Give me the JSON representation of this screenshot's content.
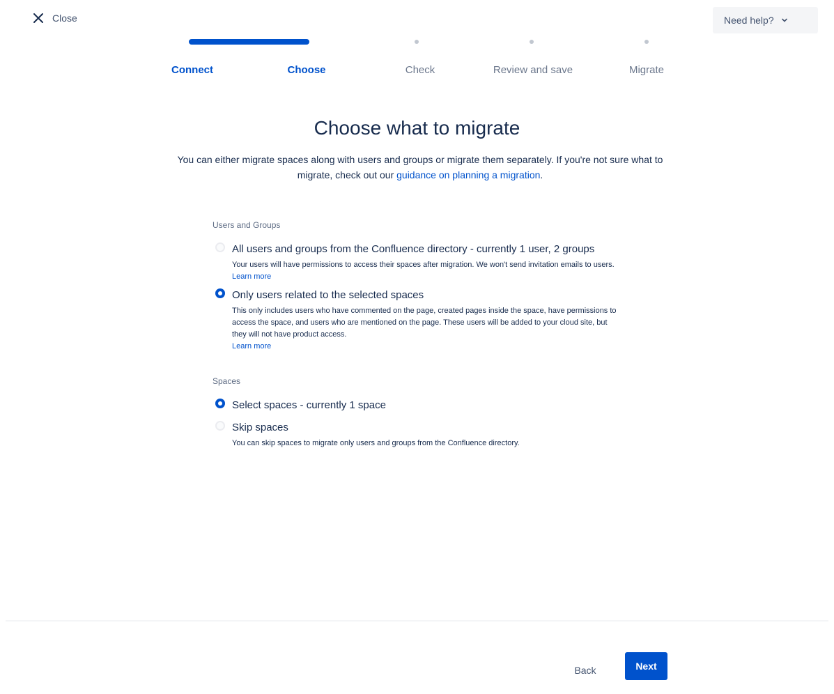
{
  "header": {
    "close_label": "Close",
    "help_label": "Need help?"
  },
  "steps": [
    {
      "label": "Connect",
      "state": "done"
    },
    {
      "label": "Choose",
      "state": "current"
    },
    {
      "label": "Check",
      "state": "pending"
    },
    {
      "label": "Review and save",
      "state": "pending"
    },
    {
      "label": "Migrate",
      "state": "pending"
    }
  ],
  "main": {
    "title": "Choose what to migrate",
    "intro_text": "You can either migrate spaces along with users and groups or migrate them separately. If you're not sure what to migrate, check out our ",
    "intro_link": "guidance on planning a migration",
    "intro_end": "."
  },
  "users_groups": {
    "section_label": "Users and Groups",
    "options": [
      {
        "title": "All users and groups from the Confluence directory - currently 1 user, 2 groups",
        "desc": "Your users will have permissions to access their spaces after migration. We won't send invitation emails to users. ",
        "link": "Learn more",
        "checked": false
      },
      {
        "title": "Only users related to the selected spaces",
        "desc": "This only includes users who have commented on the page, created pages inside the space, have permissions to access the space, and users who are mentioned on the page. These users will be added to your cloud site, but they will not have product access.",
        "link": "Learn more",
        "checked": true
      }
    ]
  },
  "spaces": {
    "section_label": "Spaces",
    "options": [
      {
        "title": "Select spaces - currently 1 space",
        "checked": true
      },
      {
        "title": "Skip spaces",
        "desc": "You can skip spaces to migrate only users and groups from the Confluence directory.",
        "checked": false
      }
    ]
  },
  "footer": {
    "back_label": "Back",
    "next_label": "Next"
  },
  "colors": {
    "accent": "#0052cc",
    "text": "#172b4d",
    "muted": "#6b778c"
  }
}
